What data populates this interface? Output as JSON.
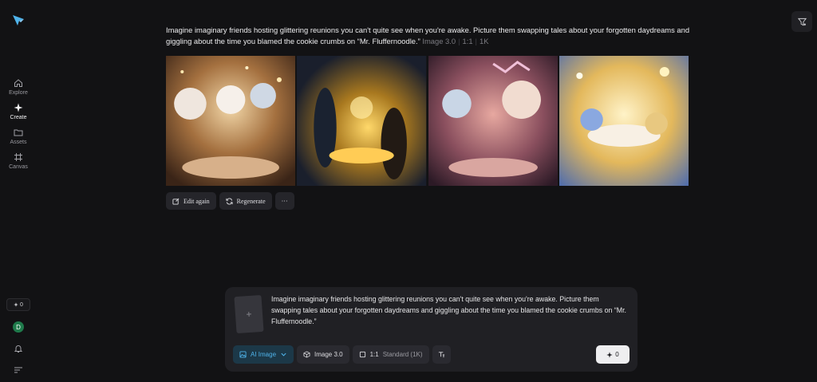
{
  "sidebar": {
    "items": [
      {
        "label": "Explore"
      },
      {
        "label": "Create"
      },
      {
        "label": "Assets"
      },
      {
        "label": "Canvas"
      }
    ],
    "credits": "0",
    "avatar_initial": "D"
  },
  "result": {
    "prompt": "Imagine imaginary friends hosting glittering reunions you can't quite see when you're awake. Picture them swapping tales about your forgotten daydreams and giggling about the time you blamed the cookie crumbs on “Mr. Fluffernoodle.”",
    "model": "Image 3.0",
    "ratio": "1:1",
    "resolution": "1K",
    "actions": {
      "edit_label": "Edit again",
      "regenerate_label": "Regenerate",
      "more_label": "···"
    }
  },
  "composer": {
    "prompt": "Imagine imaginary friends hosting glittering reunions you can't quite see when you're awake. Picture them swapping tales about your forgotten daydreams and giggling about the time you blamed the cookie crumbs on “Mr. Fluffernoodle.”",
    "mode_label": "AI Image",
    "model_label": "Image 3.0",
    "ratio_label": "1:1",
    "quality_label": "Standard (1K)",
    "send_count": "0"
  },
  "colors": {
    "background": "#121214",
    "accent": "#4fb3ea",
    "panel": "#202024"
  }
}
